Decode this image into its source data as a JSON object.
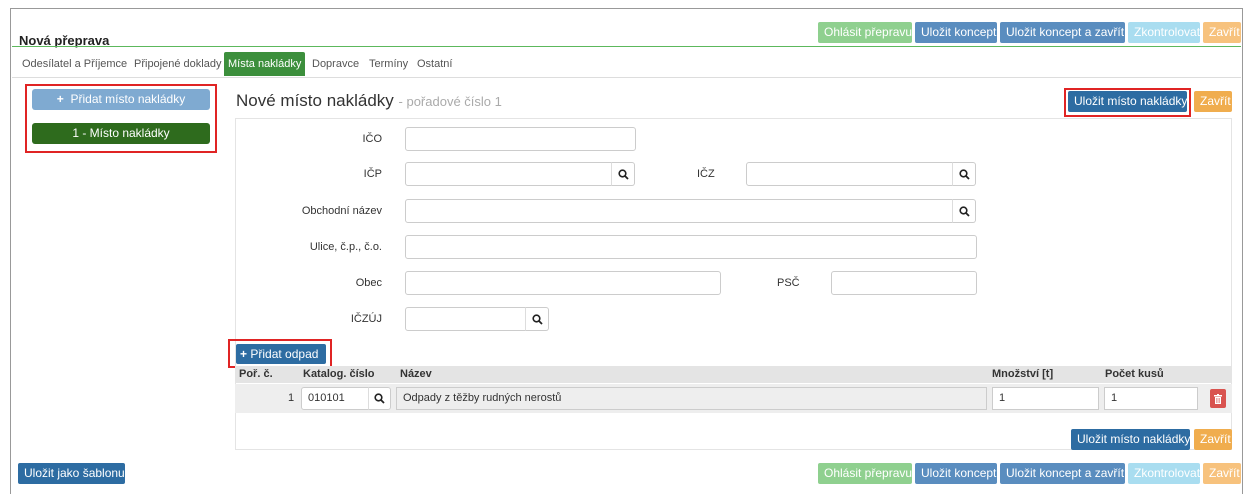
{
  "header": {
    "title": "Nová přeprava",
    "buttons": {
      "ohlasit": "Ohlásit přepravu",
      "ulozit_koncept": "Uložit koncept",
      "ulozit_koncept_zavrit": "Uložit koncept a zavřít",
      "zkontrolovat": "Zkontrolovat",
      "zavrit": "Zavřít"
    }
  },
  "tabs": [
    "Odesílatel a Příjemce",
    "Připojené doklady",
    "Místa nakládky",
    "Dopravce",
    "Termíny",
    "Ostatní"
  ],
  "sidebar": {
    "add_label": "Přidat místo nakládky",
    "items": [
      "1 - Místo nakládky"
    ]
  },
  "form": {
    "title": "Nové místo nakládky",
    "subtitle": "- pořadové číslo 1",
    "save_label": "Uložit místo nakládky",
    "close_label": "Zavřít",
    "fields": {
      "ico": "IČO",
      "icp": "IČP",
      "icz": "IČZ",
      "obchodni_nazev": "Obchodní název",
      "ulice": "Ulice, č.p., č.o.",
      "obec": "Obec",
      "psc": "PSČ",
      "iczuj": "IČZÚJ"
    }
  },
  "waste": {
    "add_label": "Přidat odpad",
    "columns": [
      "Poř. č.",
      "Katalog. číslo",
      "Název",
      "Množství [t]",
      "Počet kusů"
    ],
    "rows": [
      {
        "index": "1",
        "catalog": "010101",
        "name": "Odpady z těžby rudných nerostů",
        "quantity": "1",
        "count": "1"
      }
    ]
  },
  "footer": {
    "save_template": "Uložit jako šablonu"
  },
  "colors": {
    "accent_green": "#3c8f3c",
    "primary_blue": "#2d6ca2",
    "warning_orange": "#f0ad4e",
    "danger_red": "#d9534f",
    "highlight_red": "#e02424"
  }
}
